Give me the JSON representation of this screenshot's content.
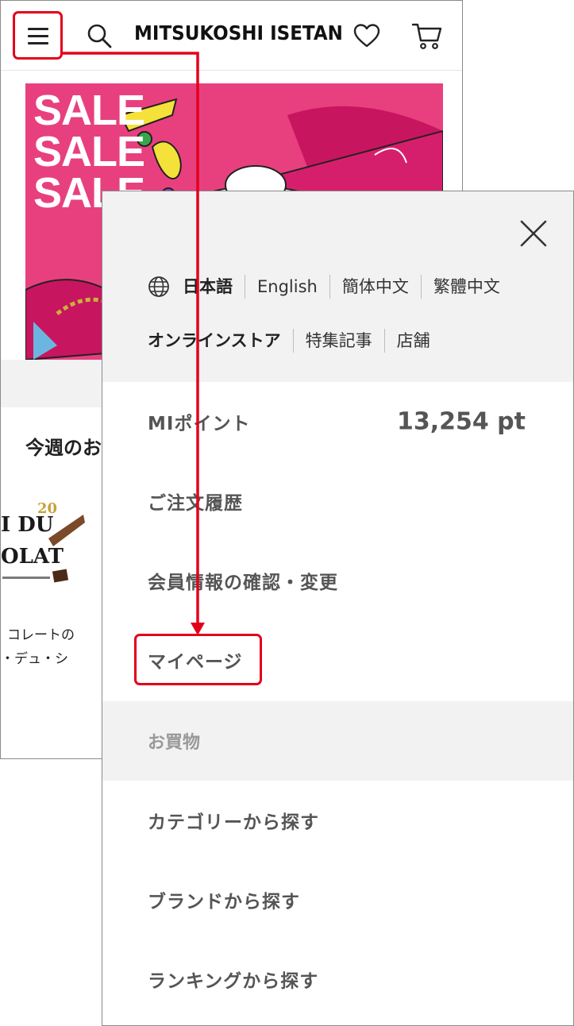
{
  "header": {
    "brand": "MITSUKOSHI ISETAN"
  },
  "banner": {
    "sale_lines": [
      "SALE",
      "SALE",
      "SALE"
    ],
    "background_color": "#e8407f"
  },
  "home": {
    "weekly_title": "今週のお",
    "product_logo_lines": [
      "I DU",
      "OLAT"
    ],
    "product_badge": "20",
    "product_name_line1": "コレートの",
    "product_name_line2": "・デュ・シ"
  },
  "menu": {
    "languages": [
      "日本語",
      "English",
      "簡体中文",
      "繁體中文"
    ],
    "sites": [
      "オンラインストア",
      "特集記事",
      "店舗"
    ],
    "mi_point_label": "MIポイント",
    "mi_point_value": "13,254 pt",
    "order_history": "ご注文履歴",
    "member_info": "会員情報の確認・変更",
    "mypage": "マイページ",
    "shopping_section": "お買物",
    "category_search": "カテゴリーから探す",
    "brand_search": "ブランドから探す",
    "ranking_search": "ランキングから探す"
  },
  "colors": {
    "highlight": "#e3001b",
    "panel_gray": "#f2f2f2"
  }
}
